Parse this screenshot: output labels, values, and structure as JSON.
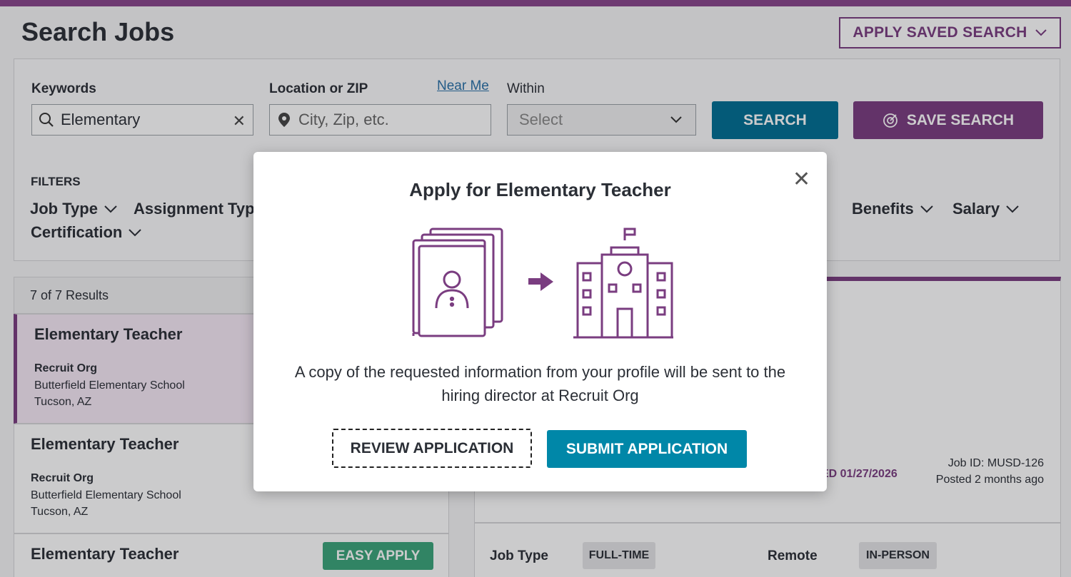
{
  "header": {
    "title": "Search Jobs",
    "saved_search_label": "APPLY SAVED SEARCH"
  },
  "search": {
    "keywords_label": "Keywords",
    "keywords_value": "Elementary",
    "location_label": "Location or ZIP",
    "near_me_label": "Near Me",
    "location_placeholder": "City, Zip, etc.",
    "within_label": "Within",
    "within_placeholder": "Select",
    "search_button": "SEARCH",
    "save_button": "SAVE SEARCH"
  },
  "filters": {
    "title": "FILTERS",
    "items": [
      "Job Type",
      "Assignment Typ",
      "Benefits",
      "Salary",
      "Certification"
    ]
  },
  "results": {
    "count_text": "7 of 7 Results",
    "items": [
      {
        "title": "Elementary Teacher",
        "org": "Recruit Org",
        "school": "Butterfield Elementary School",
        "location": "Tucson, AZ"
      },
      {
        "title": "Elementary Teacher",
        "org": "Recruit Org",
        "school": "Butterfield Elementary School",
        "location": "Tucson, AZ"
      },
      {
        "title": "Elementary Teacher",
        "badge": "EASY APPLY"
      }
    ]
  },
  "detail": {
    "closed_text": "ED 01/27/2026",
    "job_id": "Job ID: MUSD-126",
    "posted": "Posted 2 months ago",
    "job_type_label": "Job Type",
    "job_type_value": "FULL-TIME",
    "remote_label": "Remote",
    "remote_value": "IN-PERSON"
  },
  "modal": {
    "title": "Apply for Elementary Teacher",
    "message": "A copy of the requested information from your profile will be sent to the hiring director at Recruit Org",
    "review_button": "REVIEW APPLICATION",
    "submit_button": "SUBMIT APPLICATION"
  },
  "colors": {
    "brand_purple": "#7a3d80",
    "brand_teal": "#006f94",
    "easy_apply_green": "#3aa57a"
  }
}
